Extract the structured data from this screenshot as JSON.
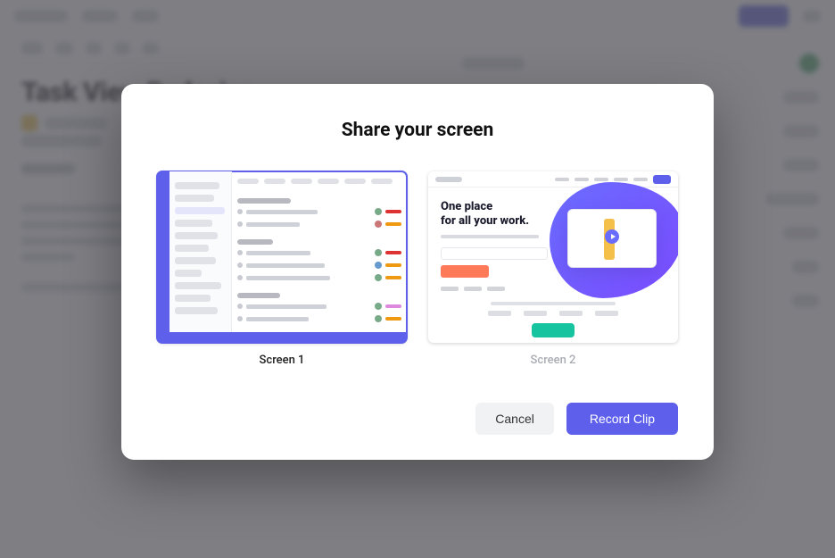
{
  "bg": {
    "title": "Task View Redesign"
  },
  "modal": {
    "title": "Share your screen",
    "screens": [
      {
        "label": "Screen 1",
        "selected": true
      },
      {
        "label": "Screen 2",
        "selected": false
      }
    ],
    "screen2_preview": {
      "headline_line1": "One place",
      "headline_line2": "for all your work."
    },
    "cancel_label": "Cancel",
    "record_label": "Record Clip"
  }
}
